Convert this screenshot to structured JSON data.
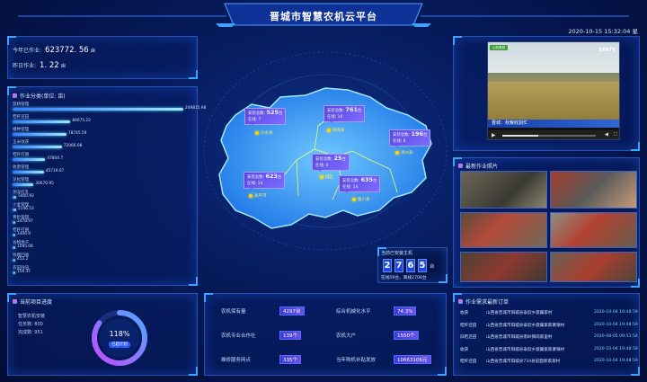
{
  "header": {
    "title": "晋城市智慧农机云平台",
    "datetime": "2020-10-15 15:32:04 星"
  },
  "summary": {
    "year_label": "今年已作业:",
    "year_value": "623772. 56",
    "year_unit": "亩",
    "today_label": "昨日作业:",
    "today_value": "1. 22",
    "today_unit": "亩"
  },
  "work_panel": {
    "title": "作业分类(单位: 亩)"
  },
  "chart_data": {
    "type": "bar",
    "orientation": "horizontal",
    "title": "作业分类(单位: 亩)",
    "categories": [
      "旋耕管理",
      "秸秆还田",
      "播种管理",
      "玉米收获",
      "秸秆打捆",
      "收割管理",
      "深松管理",
      "测深打孔",
      "小麦管理",
      "青贮管理",
      "秸秆打捆",
      "谷物烘干",
      "残膜回收",
      "农田除虫"
    ],
    "values": [
      249815.98,
      84675.22,
      78745.59,
      72066.08,
      47804.7,
      45719.07,
      30670.95,
      5400.92,
      5146.53,
      2478.97,
      1406.9,
      1095.08,
      452.2,
      156.37
    ],
    "value_labels": [
      "249815.98",
      "84675.22",
      "78745.59",
      "72066.08",
      "47804.7",
      "45719.07",
      "30670.95",
      "5400.92",
      "5146.53",
      "2478.97",
      "1406.9",
      "1095.08",
      "452.2",
      "156.37"
    ]
  },
  "progress_panel": {
    "title": "当前项目进度",
    "line1": "智慧农机安装",
    "line2": "任务数: 800",
    "line3": "完成数: 951",
    "percent_text": "118%",
    "percent_value": 118,
    "sub": "已超计划"
  },
  "video_panel": {
    "channel": "SXNTV",
    "caption": "晋城：秋粮收割忙",
    "logo_text": "山西晋城"
  },
  "photos_panel": {
    "title": "最新作业照片"
  },
  "map": {
    "bubbles": [
      {
        "id": "a",
        "label1": "安装总数:",
        "num": "525",
        "unit": "台",
        "label2": "在线: 7"
      },
      {
        "id": "b",
        "label1": "安装总数:",
        "num": "761",
        "unit": "台",
        "label2": "在线: 16"
      },
      {
        "id": "c",
        "label1": "安装总数:",
        "num": "196",
        "unit": "台",
        "label2": "在线: 8"
      },
      {
        "id": "d",
        "label1": "安装总数:",
        "num": "25",
        "unit": "台",
        "label2": "在线: 0"
      },
      {
        "id": "e",
        "label1": "安装总数:",
        "num": "623",
        "unit": "台",
        "label2": "在线: 14"
      },
      {
        "id": "f",
        "label1": "安装总数:",
        "num": "635",
        "unit": "台",
        "label2": "在线: 14"
      }
    ],
    "places": [
      "沁水县",
      "阳城县",
      "泽州县",
      "城区",
      "高平市",
      "陵川县"
    ],
    "install": {
      "title": "当前已安装主机",
      "digits": [
        "2",
        "7",
        "6",
        "5"
      ],
      "unit": "台",
      "footer": "在线59台，离线2706台"
    }
  },
  "center_stats": {
    "items": [
      {
        "label": "农机保有量",
        "value": "4297台"
      },
      {
        "label": "综合机械化水平",
        "value": "74.3%"
      },
      {
        "label": "农机专业合作社",
        "value": "139个"
      },
      {
        "label": "农机大户",
        "value": "1550个"
      },
      {
        "label": "维修服务网点",
        "value": "335个"
      },
      {
        "label": "当年购机补贴发放",
        "value": "10663106元"
      }
    ]
  },
  "orders_panel": {
    "title": "作业需求最新订单",
    "rows": [
      {
        "type": "收获",
        "desc": "山西省晋城市阳城县泰欣乡傲翼家村",
        "time": "2020-10-04 19:48:59"
      },
      {
        "type": "秸秆还田",
        "desc": "山西省晋城市阳城县泰欣乡傲翼家家寨镇村",
        "time": "2020-10-04 19:48:59"
      },
      {
        "type": "旧秸还田",
        "desc": "山西省晋城市阳城县南岭镇岗家里村",
        "time": "2020-08-05 09:53:54"
      },
      {
        "type": "收获",
        "desc": "山西省晋城市阳城县泰欣乡傲翼家家寨镇村",
        "time": "2020-10-04 19:48:59"
      },
      {
        "type": "秸秆还田",
        "desc": "山西省晋城市阳城县734县前面新家家村",
        "time": "2020-10-04 19:48:59"
      }
    ]
  },
  "colors": {
    "accent": "#3fa2ff",
    "bar": "#5fd2ff",
    "bubble": "#6a58f0",
    "gold": "#ffd500"
  }
}
